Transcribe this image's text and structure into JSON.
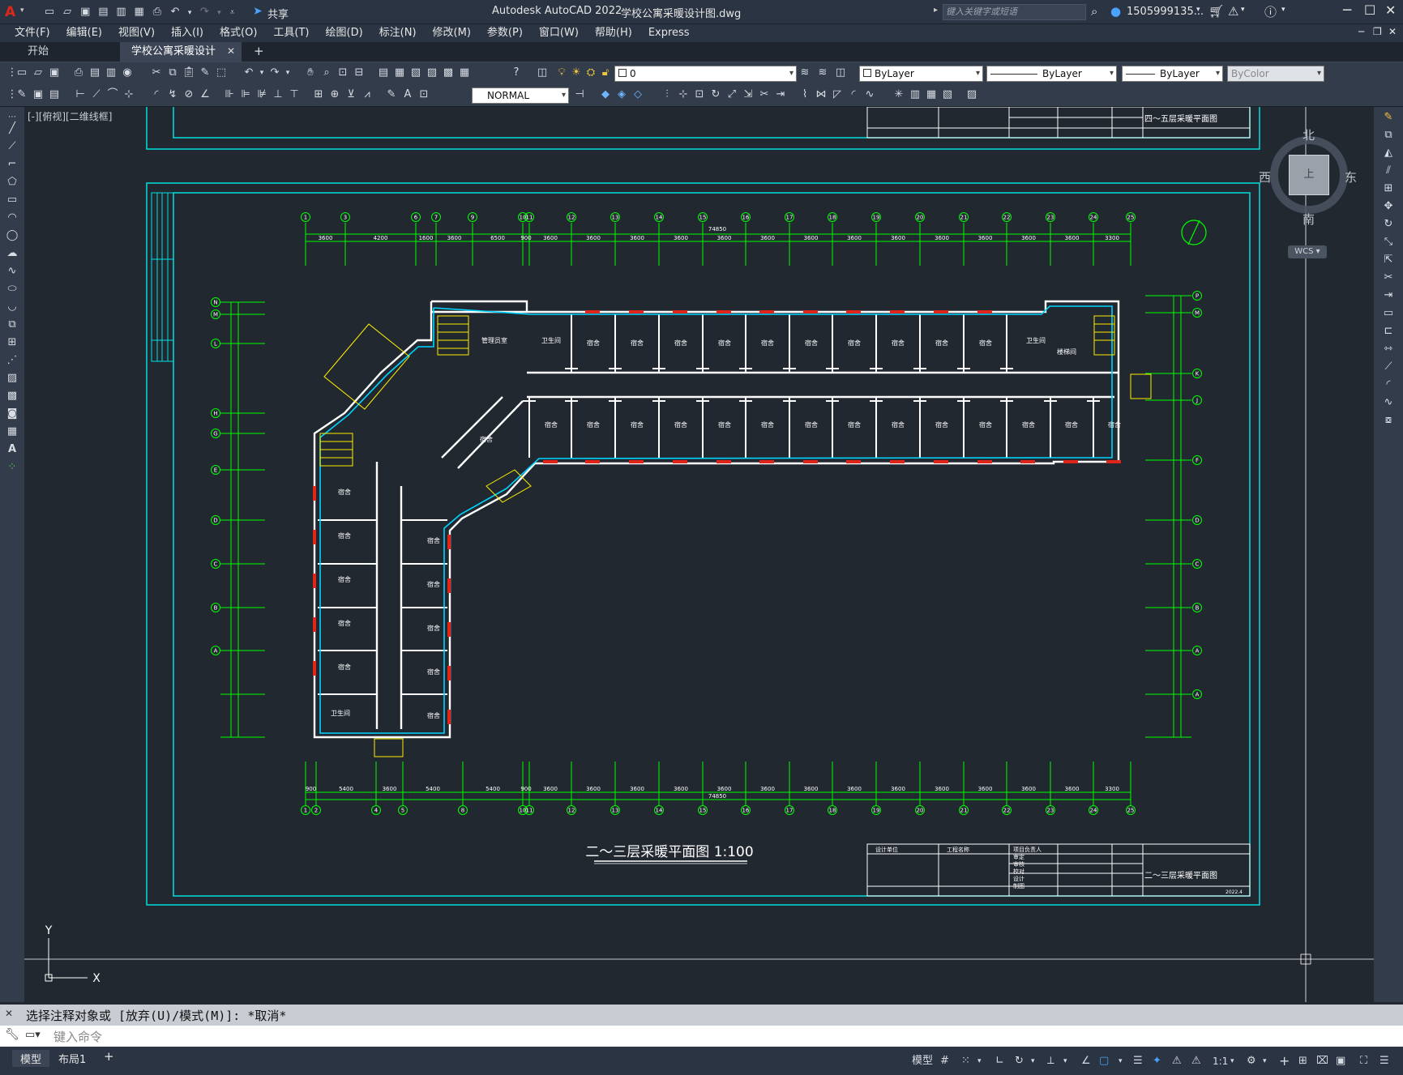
{
  "app": {
    "title": "Autodesk AutoCAD 2022",
    "filename": "学校公寓采暖设计图.dwg",
    "share": "共享",
    "search_placeholder": "键入关键字或短语",
    "user": "1505999135...",
    "accent": "#e0261b"
  },
  "menu": [
    "文件(F)",
    "编辑(E)",
    "视图(V)",
    "插入(I)",
    "格式(O)",
    "工具(T)",
    "绘图(D)",
    "标注(N)",
    "修改(M)",
    "参数(P)",
    "窗口(W)",
    "帮助(H)",
    "Express"
  ],
  "tabs": {
    "start": "开始",
    "doc": "学校公寓采暖设计图*",
    "add": "+"
  },
  "toolbar": {
    "layer": "0",
    "color": "ByLayer",
    "linetype": "ByLayer",
    "lineweight": "ByLayer",
    "plotstyle": "ByColor",
    "dimstyle": "NORMAL"
  },
  "viewport": {
    "label": "[-][俯视][二维线框]",
    "compass": {
      "n": "北",
      "s": "南",
      "e": "东",
      "w": "西",
      "center": "上"
    },
    "wcs": "WCS ▾"
  },
  "drawing": {
    "title": "二～三层采暖平面图 1:100",
    "titleblock_name": "二～三层采暖平面图",
    "titleblock_prev": "四～五层采暖平面图",
    "dim_total": "74850",
    "dims_top": [
      "3600",
      "4200",
      "1600",
      "3600",
      "6500",
      "900",
      "3600",
      "3600",
      "3600",
      "3600",
      "3600",
      "3600",
      "3600",
      "3600",
      "3600",
      "3600",
      "3600",
      "3600",
      "3600",
      "3300"
    ],
    "dims_bottom": [
      "900",
      "5400",
      "3600",
      "5400",
      "5400",
      "900",
      "3600",
      "3600",
      "3600",
      "3600",
      "3600",
      "3600",
      "3600",
      "3600",
      "3600",
      "3600",
      "3600",
      "3600",
      "3600",
      "3300"
    ],
    "grid_top": [
      "1",
      "3",
      "6",
      "7",
      "9",
      "10",
      "11",
      "12",
      "13",
      "14",
      "15",
      "16",
      "17",
      "18",
      "19",
      "20",
      "21",
      "22",
      "23",
      "24",
      "25"
    ],
    "grid_bottom": [
      "1",
      "2",
      "4",
      "5",
      "8",
      "10",
      "11",
      "12",
      "13",
      "14",
      "15",
      "16",
      "17",
      "18",
      "19",
      "20",
      "21",
      "22",
      "23",
      "24",
      "25"
    ],
    "grid_left": [
      "N",
      "M",
      "L",
      "H",
      "G",
      "E",
      "D",
      "C",
      "B",
      "A",
      "B",
      "A"
    ],
    "grid_right": [
      "P",
      "M",
      "K",
      "J",
      "F",
      "D",
      "C",
      "B",
      "A",
      "A"
    ],
    "room_label": "宿舍",
    "room_toilet": "卫生间",
    "room_stair": "楼梯间",
    "room_duty": "管理员室",
    "tb_row1": [
      "设计单位",
      "工程名称",
      "项目负责人",
      "审定",
      "审核",
      "校对",
      "设计",
      "制图"
    ],
    "tb_footer": "2022.4"
  },
  "axes": {
    "x": "X",
    "y": "Y"
  },
  "command": {
    "history": "选择注释对象或 [放弃(U)/模式(M)]: *取消*",
    "placeholder": "键入命令"
  },
  "status": {
    "model": "模型",
    "layout1": "布局1",
    "add": "+",
    "model_btn": "模型",
    "scale": "1:1"
  }
}
